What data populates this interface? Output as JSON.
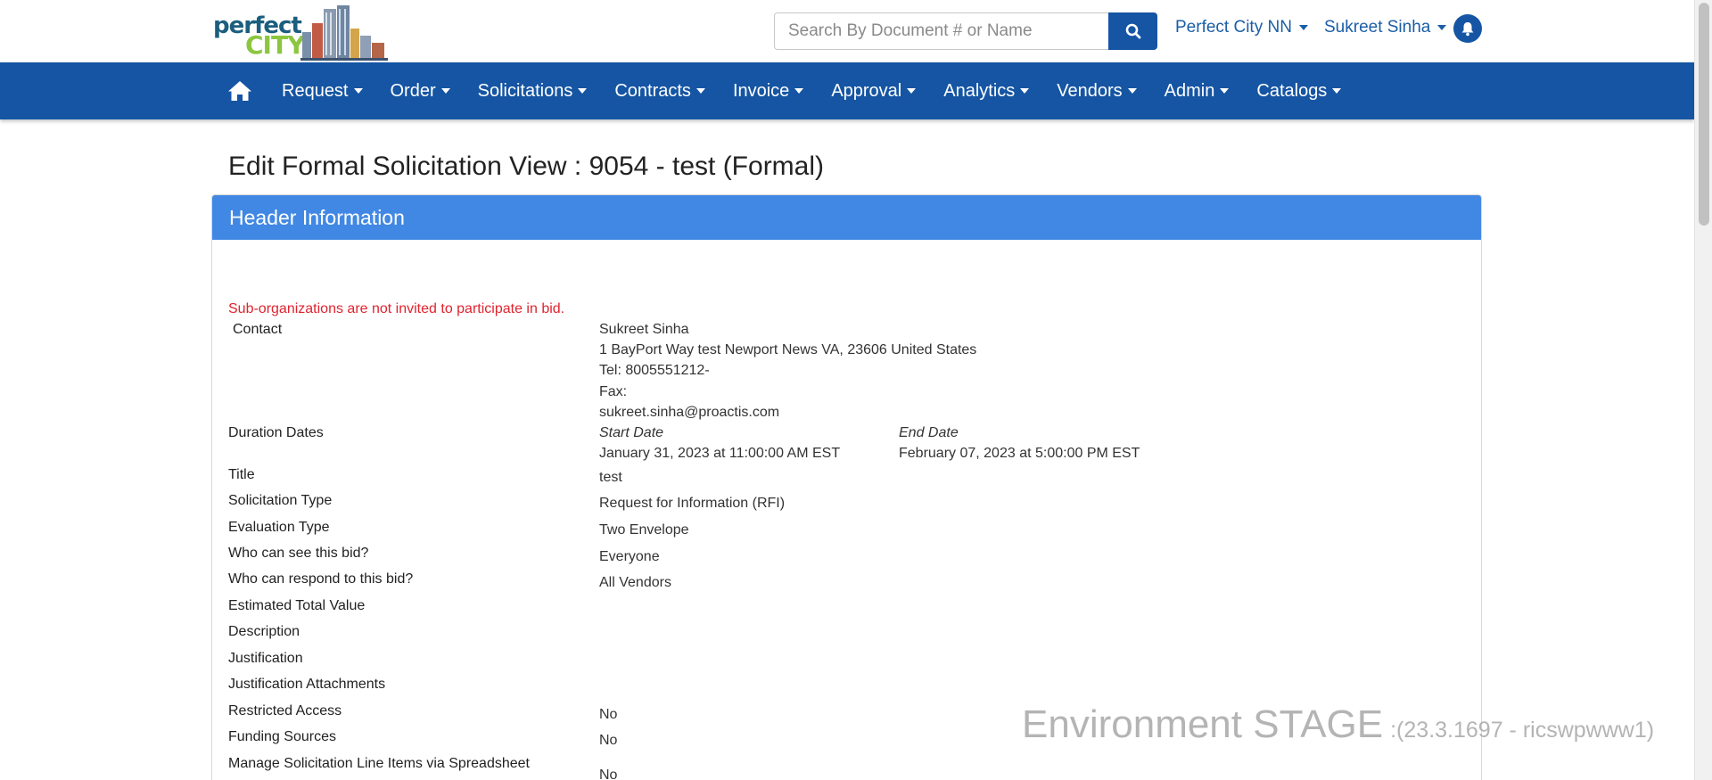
{
  "brand": {
    "logo_word1": "perfect",
    "logo_word2": "CITY",
    "logo_colors": {
      "word1": "#1b5e7e",
      "word2": "#8cc63f"
    }
  },
  "search": {
    "placeholder": "Search By Document # or Name",
    "button_icon": "search-icon"
  },
  "top_menu": {
    "organization": "Perfect City NN",
    "user": "Sukreet Sinha",
    "notification_icon": "bell-icon"
  },
  "nav": {
    "home_icon": "home-icon",
    "items": [
      {
        "label": "Request"
      },
      {
        "label": "Order"
      },
      {
        "label": "Solicitations"
      },
      {
        "label": "Contracts"
      },
      {
        "label": "Invoice"
      },
      {
        "label": "Approval"
      },
      {
        "label": "Analytics"
      },
      {
        "label": "Vendors"
      },
      {
        "label": "Admin"
      },
      {
        "label": "Catalogs"
      }
    ]
  },
  "page": {
    "title": "Edit Formal Solicitation View : 9054 - test (Formal)"
  },
  "panel": {
    "header": "Header Information",
    "warning": "Sub-organizations are not invited to participate in bid.",
    "contact": {
      "label": "Contact",
      "name": "Sukreet Sinha",
      "address": "1 BayPort Way test Newport News VA, 23606 United States",
      "tel": "Tel: 8005551212-",
      "fax": "Fax:",
      "email": "sukreet.sinha@proactis.com"
    },
    "duration": {
      "label": "Duration Dates",
      "start_heading": "Start Date",
      "start_value": "January 31, 2023 at 11:00:00 AM EST",
      "end_heading": "End Date",
      "end_value": "February 07, 2023 at 5:00:00 PM EST"
    },
    "fields": [
      {
        "label": "Title",
        "value": "test"
      },
      {
        "label": "Solicitation Type",
        "value": "Request for Information (RFI)"
      },
      {
        "label": "Evaluation Type",
        "value": "Two Envelope"
      },
      {
        "label": "Who can see this bid?",
        "value": "Everyone"
      },
      {
        "label": "Who can respond to this bid?",
        "value": "All Vendors"
      },
      {
        "label": "Estimated Total Value",
        "value": ""
      },
      {
        "label": "Description",
        "value": ""
      },
      {
        "label": "Justification",
        "value": ""
      },
      {
        "label": "Justification Attachments",
        "value": ""
      },
      {
        "label": "Restricted Access",
        "value": "No"
      },
      {
        "label": "Funding Sources",
        "value": "No"
      },
      {
        "label": "Manage Solicitation Line Items via Spreadsheet",
        "value": "No"
      }
    ]
  },
  "environment": {
    "name": "Environment STAGE",
    "build": ":(23.3.1697 - ricswpwww1)"
  },
  "colors": {
    "navbar": "#1555a3",
    "panel_header": "#4188e4",
    "warning": "#e0242f",
    "link": "#1b5ea6"
  }
}
